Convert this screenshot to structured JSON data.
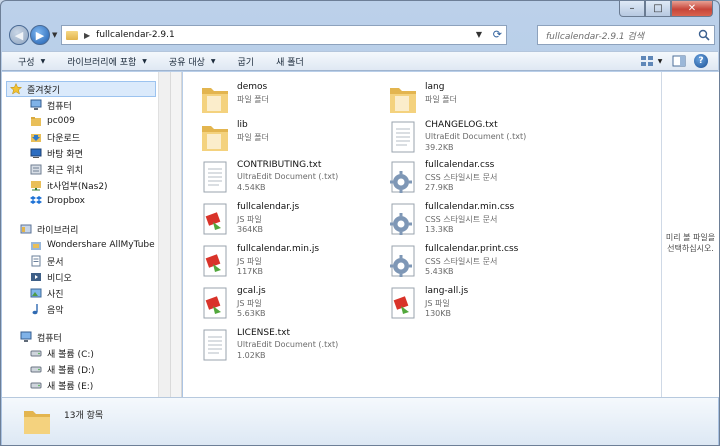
{
  "window": {
    "title": "fullcalendar-2.9.1",
    "caption_buttons": {
      "minimize": "–",
      "maximize": "□",
      "close": "✕"
    }
  },
  "address": {
    "path": "fullcalendar-2.9.1",
    "search_placeholder": "fullcalendar-2.9.1 검색"
  },
  "toolbar": {
    "items": [
      "구성",
      "라이브러리에 포함",
      "공유 대상",
      "굽기",
      "새 폴더"
    ]
  },
  "sidebar": {
    "favorites_header": "즐겨찾기",
    "favorites": [
      "컴퓨터",
      "pc009",
      "다운로드",
      "바탕 화면",
      "최근 위치",
      "it사업부(Nas2)",
      "Dropbox"
    ],
    "libraries_header": "라이브러리",
    "libraries": [
      "Wondershare AllMyTube",
      "문서",
      "비디오",
      "사진",
      "음악"
    ],
    "computer_header": "컴퓨터",
    "drives": [
      "새 볼륨 (C:)",
      "새 볼륨 (D:)",
      "새 볼륨 (E:)"
    ]
  },
  "files": [
    {
      "name": "demos",
      "type": "파일 폴더",
      "size": "",
      "kind": "folder"
    },
    {
      "name": "lib",
      "type": "파일 폴더",
      "size": "",
      "kind": "folder"
    },
    {
      "name": "CONTRIBUTING.txt",
      "type": "UltraEdit Document (.txt)",
      "size": "4.54KB",
      "kind": "txt"
    },
    {
      "name": "fullcalendar.js",
      "type": "JS 파일",
      "size": "364KB",
      "kind": "js"
    },
    {
      "name": "fullcalendar.min.js",
      "type": "JS 파일",
      "size": "117KB",
      "kind": "js"
    },
    {
      "name": "gcal.js",
      "type": "JS 파일",
      "size": "5.63KB",
      "kind": "js"
    },
    {
      "name": "LICENSE.txt",
      "type": "UltraEdit Document (.txt)",
      "size": "1.02KB",
      "kind": "txt"
    },
    {
      "name": "lang",
      "type": "파일 폴더",
      "size": "",
      "kind": "folder"
    },
    {
      "name": "CHANGELOG.txt",
      "type": "UltraEdit Document (.txt)",
      "size": "39.2KB",
      "kind": "txt"
    },
    {
      "name": "fullcalendar.css",
      "type": "CSS 스타일시트 문서",
      "size": "27.9KB",
      "kind": "css"
    },
    {
      "name": "fullcalendar.min.css",
      "type": "CSS 스타일시트 문서",
      "size": "13.3KB",
      "kind": "css"
    },
    {
      "name": "fullcalendar.print.css",
      "type": "CSS 스타일시트 문서",
      "size": "5.43KB",
      "kind": "css"
    },
    {
      "name": "lang-all.js",
      "type": "JS 파일",
      "size": "130KB",
      "kind": "js"
    }
  ],
  "preview_text": "미리 볼 파일을 선택하십시오.",
  "status": {
    "item_count": "13개 항목"
  }
}
